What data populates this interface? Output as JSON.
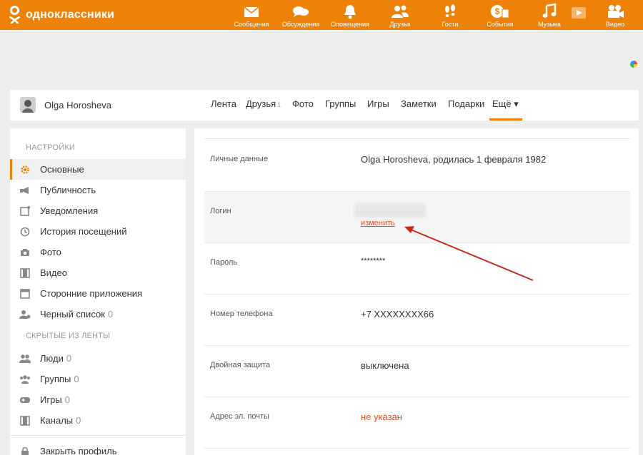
{
  "brand": {
    "name": "одноклассники",
    "color": "#ee8208"
  },
  "nav": [
    {
      "icon": "envelope-icon",
      "label": "Сообщения"
    },
    {
      "icon": "chat-icon",
      "label": "Обсуждения"
    },
    {
      "icon": "bell-icon",
      "label": "Оповещения"
    },
    {
      "icon": "friends-icon",
      "label": "Друзья"
    },
    {
      "icon": "footprints-icon",
      "label": "Гости"
    },
    {
      "icon": "events-icon",
      "label": "События"
    },
    {
      "icon": "music-icon",
      "label": "Музыка"
    },
    {
      "icon": "video-play-icon",
      "label": ""
    },
    {
      "icon": "video-camera-icon",
      "label": "Видео"
    }
  ],
  "profile": {
    "name": "Olga Horosheva",
    "tabs": [
      {
        "label": "Лента"
      },
      {
        "label": "Друзья",
        "count": "1"
      },
      {
        "label": "Фото"
      },
      {
        "label": "Группы"
      },
      {
        "label": "Игры"
      },
      {
        "label": "Заметки"
      },
      {
        "label": "Подарки"
      },
      {
        "label": "Ещё ▾"
      }
    ]
  },
  "sidebar": {
    "settings_header": "Настройки",
    "settings_items": [
      {
        "label": "Основные",
        "icon": "gear-icon",
        "active": true
      },
      {
        "label": "Публичность",
        "icon": "megaphone-icon"
      },
      {
        "label": "Уведомления",
        "icon": "notification-icon"
      },
      {
        "label": "История посещений",
        "icon": "history-icon"
      },
      {
        "label": "Фото",
        "icon": "camera-icon"
      },
      {
        "label": "Видео",
        "icon": "film-icon"
      },
      {
        "label": "Сторонние приложения",
        "icon": "apps-icon"
      },
      {
        "label": "Черный список",
        "icon": "blocked-user-icon",
        "count": "0"
      }
    ],
    "hidden_header": "Скрытые из ленты",
    "hidden_items": [
      {
        "label": "Люди",
        "icon": "people-icon",
        "count": "0"
      },
      {
        "label": "Группы",
        "icon": "groups-icon",
        "count": "0"
      },
      {
        "label": "Игры",
        "icon": "gamepad-icon",
        "count": "0"
      },
      {
        "label": "Каналы",
        "icon": "channels-icon",
        "count": "0"
      }
    ],
    "close_profile": {
      "label": "Закрыть профиль",
      "icon": "lock-icon"
    }
  },
  "settings": {
    "personal": {
      "label": "Личные данные",
      "value": "Olga Horosheva, родилась 1 февраля 1982"
    },
    "login": {
      "label": "Логин",
      "change_link": "изменить"
    },
    "password": {
      "label": "Пароль",
      "value": "********"
    },
    "phone": {
      "label": "Номер телефона",
      "value": "+7 XXXXXXXX66"
    },
    "two_factor": {
      "label": "Двойная защита",
      "value": "выключена"
    },
    "email": {
      "label": "Адрес эл. почты",
      "value": "не указан"
    }
  },
  "annotation": {
    "arrow_color": "#c8281e"
  }
}
